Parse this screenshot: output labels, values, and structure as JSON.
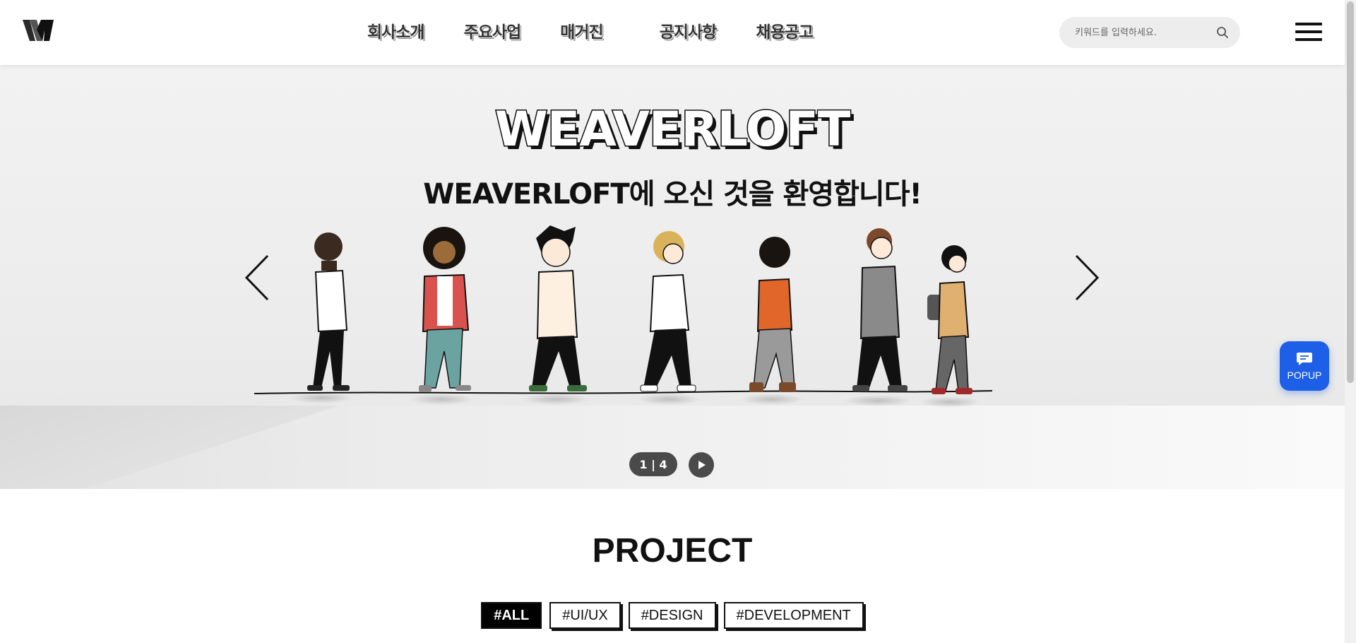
{
  "header": {
    "logo_text": "W",
    "nav": [
      {
        "label": "회사소개"
      },
      {
        "label": "주요사업"
      },
      {
        "label": "매거진"
      },
      {
        "label": "공지사항"
      },
      {
        "label": "채용공고"
      }
    ],
    "search": {
      "placeholder": "키워드를 입력하세요.",
      "value": ""
    },
    "icons": {
      "search": "search-icon",
      "menu": "hamburger-menu-icon"
    }
  },
  "hero": {
    "title": "WEAVERLOFT",
    "subtitle": "WEAVERLOFT에 오신 것을 환영합니다!",
    "slide_indicator": "1 | 4",
    "icons": {
      "prev": "chevron-left-icon",
      "next": "chevron-right-icon",
      "play": "play-icon"
    }
  },
  "popup": {
    "label": "POPUP",
    "icon": "chat-bubble-icon",
    "color": "#1d5fe6"
  },
  "project": {
    "title": "PROJECT",
    "tags": [
      {
        "label": "#ALL",
        "active": true
      },
      {
        "label": "#UI/UX",
        "active": false
      },
      {
        "label": "#DESIGN",
        "active": false
      },
      {
        "label": "#DEVELOPMENT",
        "active": false
      }
    ]
  }
}
